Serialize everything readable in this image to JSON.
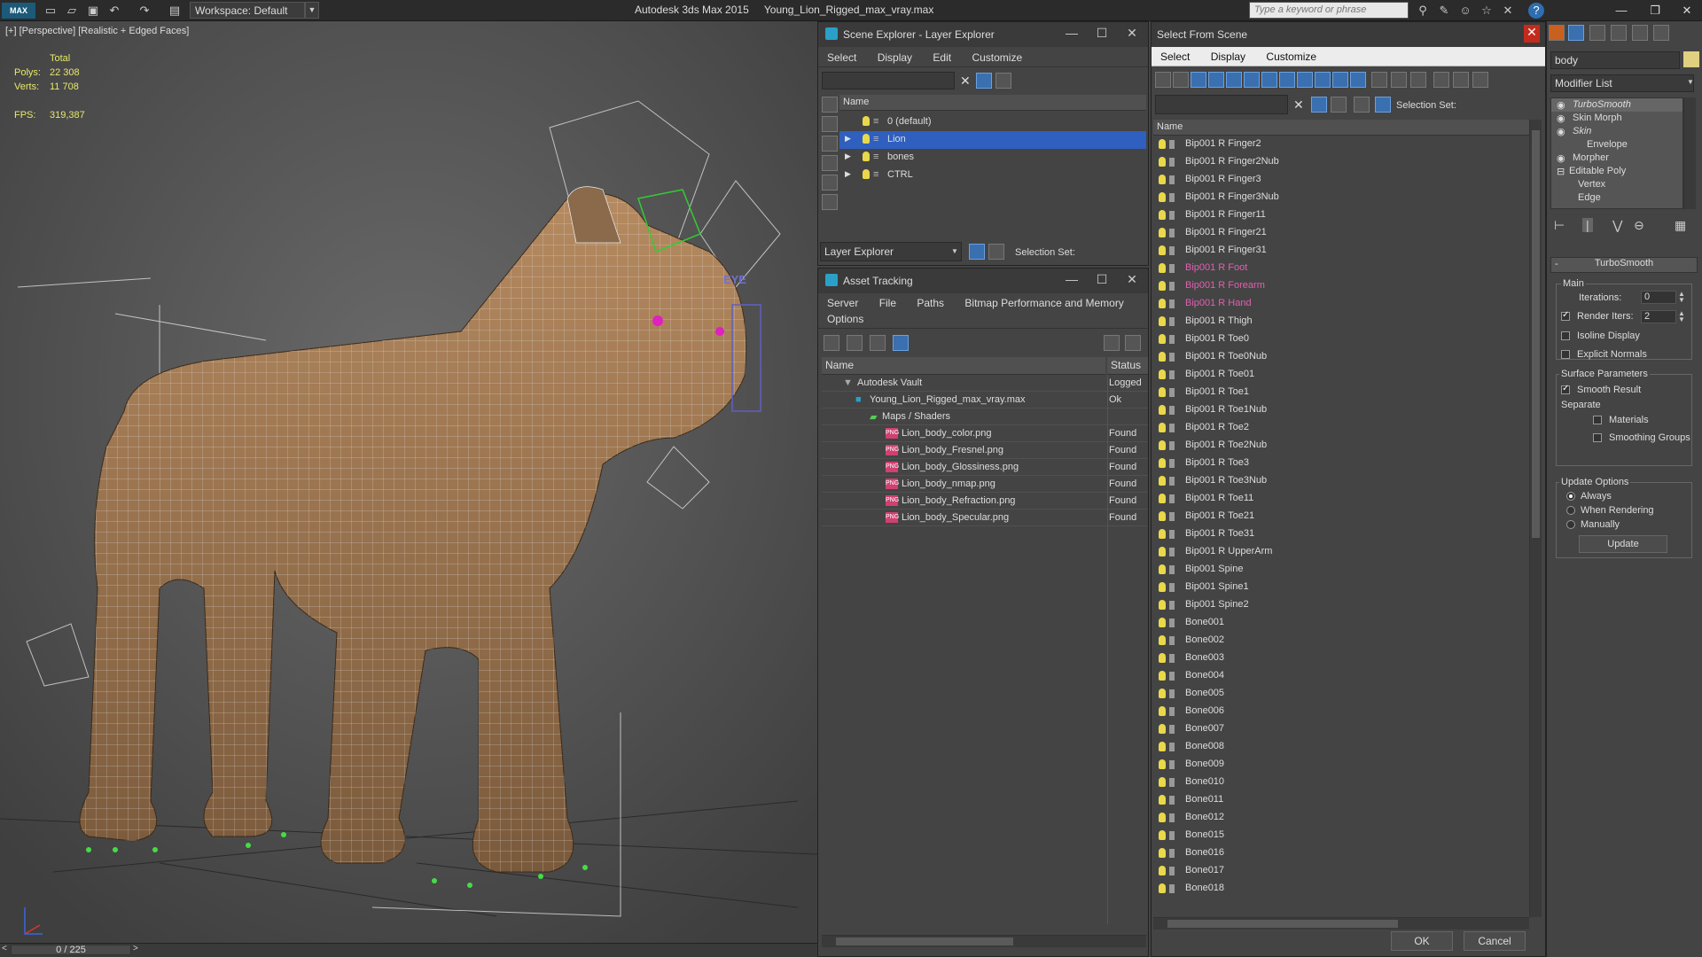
{
  "titlebar": {
    "workspace": "Workspace: Default",
    "app_name": "Autodesk 3ds Max  2015",
    "file_name": "Young_Lion_Rigged_max_vray.max",
    "search_placeholder": "Type a keyword or phrase"
  },
  "viewport": {
    "label": "[+] [Perspective] [Realistic + Edged Faces]",
    "stats": {
      "total_label": "Total",
      "polys_label": "Polys:",
      "polys_value": "22 308",
      "verts_label": "Verts:",
      "verts_value": "11 708",
      "fps_label": "FPS:",
      "fps_value": "319,387"
    },
    "eye_label": "EYE",
    "time_slider": "0 / 225"
  },
  "scene_explorer": {
    "title": "Scene Explorer - Layer Explorer",
    "menu": [
      "Select",
      "Display",
      "Edit",
      "Customize"
    ],
    "column_name": "Name",
    "layers": [
      {
        "name": "0 (default)",
        "selected": false,
        "expandable": false
      },
      {
        "name": "Lion",
        "selected": true,
        "expandable": true
      },
      {
        "name": "bones",
        "selected": false,
        "expandable": true
      },
      {
        "name": "CTRL",
        "selected": false,
        "expandable": true
      }
    ],
    "bottom_dropdown": "Layer Explorer",
    "selection_set_label": "Selection Set:"
  },
  "asset_tracking": {
    "title": "Asset Tracking",
    "menu": [
      "Server",
      "File",
      "Paths",
      "Bitmap Performance and Memory"
    ],
    "menu2": [
      "Options"
    ],
    "col_name": "Name",
    "col_status": "Status",
    "rows": [
      {
        "name": "Autodesk Vault",
        "status": "Logged",
        "indent": 1,
        "icon": "vault"
      },
      {
        "name": "Young_Lion_Rigged_max_vray.max",
        "status": "Ok",
        "indent": 2,
        "icon": "max"
      },
      {
        "name": "Maps / Shaders",
        "status": "",
        "indent": 3,
        "icon": "maps"
      },
      {
        "name": "Lion_body_color.png",
        "status": "Found",
        "indent": 4,
        "icon": "png"
      },
      {
        "name": "Lion_body_Fresnel.png",
        "status": "Found",
        "indent": 4,
        "icon": "png"
      },
      {
        "name": "Lion_body_Glossiness.png",
        "status": "Found",
        "indent": 4,
        "icon": "png"
      },
      {
        "name": "Lion_body_nmap.png",
        "status": "Found",
        "indent": 4,
        "icon": "png"
      },
      {
        "name": "Lion_body_Refraction.png",
        "status": "Found",
        "indent": 4,
        "icon": "png"
      },
      {
        "name": "Lion_body_Specular.png",
        "status": "Found",
        "indent": 4,
        "icon": "png"
      }
    ],
    "png_badge": "PNG"
  },
  "select_from_scene": {
    "title": "Select From Scene",
    "menu": [
      "Select",
      "Display",
      "Customize"
    ],
    "selection_set_label": "Selection Set:",
    "column_name": "Name",
    "items": [
      {
        "name": "Bip001 R Finger2",
        "pink": false
      },
      {
        "name": "Bip001 R Finger2Nub",
        "pink": false
      },
      {
        "name": "Bip001 R Finger3",
        "pink": false
      },
      {
        "name": "Bip001 R Finger3Nub",
        "pink": false
      },
      {
        "name": "Bip001 R Finger11",
        "pink": false
      },
      {
        "name": "Bip001 R Finger21",
        "pink": false
      },
      {
        "name": "Bip001 R Finger31",
        "pink": false
      },
      {
        "name": "Bip001 R Foot",
        "pink": true
      },
      {
        "name": "Bip001 R Forearm",
        "pink": true
      },
      {
        "name": "Bip001 R Hand",
        "pink": true
      },
      {
        "name": "Bip001 R Thigh",
        "pink": false
      },
      {
        "name": "Bip001 R Toe0",
        "pink": false
      },
      {
        "name": "Bip001 R Toe0Nub",
        "pink": false
      },
      {
        "name": "Bip001 R Toe01",
        "pink": false
      },
      {
        "name": "Bip001 R Toe1",
        "pink": false
      },
      {
        "name": "Bip001 R Toe1Nub",
        "pink": false
      },
      {
        "name": "Bip001 R Toe2",
        "pink": false
      },
      {
        "name": "Bip001 R Toe2Nub",
        "pink": false
      },
      {
        "name": "Bip001 R Toe3",
        "pink": false
      },
      {
        "name": "Bip001 R Toe3Nub",
        "pink": false
      },
      {
        "name": "Bip001 R Toe11",
        "pink": false
      },
      {
        "name": "Bip001 R Toe21",
        "pink": false
      },
      {
        "name": "Bip001 R Toe31",
        "pink": false
      },
      {
        "name": "Bip001 R UpperArm",
        "pink": false
      },
      {
        "name": "Bip001 Spine",
        "pink": false
      },
      {
        "name": "Bip001 Spine1",
        "pink": false
      },
      {
        "name": "Bip001 Spine2",
        "pink": false
      },
      {
        "name": "Bone001",
        "pink": false
      },
      {
        "name": "Bone002",
        "pink": false
      },
      {
        "name": "Bone003",
        "pink": false
      },
      {
        "name": "Bone004",
        "pink": false
      },
      {
        "name": "Bone005",
        "pink": false
      },
      {
        "name": "Bone006",
        "pink": false
      },
      {
        "name": "Bone007",
        "pink": false
      },
      {
        "name": "Bone008",
        "pink": false
      },
      {
        "name": "Bone009",
        "pink": false
      },
      {
        "name": "Bone010",
        "pink": false
      },
      {
        "name": "Bone011",
        "pink": false
      },
      {
        "name": "Bone012",
        "pink": false
      },
      {
        "name": "Bone015",
        "pink": false
      },
      {
        "name": "Bone016",
        "pink": false
      },
      {
        "name": "Bone017",
        "pink": false
      },
      {
        "name": "Bone018",
        "pink": false
      }
    ],
    "ok_label": "OK",
    "cancel_label": "Cancel"
  },
  "command_panel": {
    "object_name": "body",
    "modifier_list": "Modifier List",
    "stack": [
      {
        "name": "TurboSmooth",
        "italic": true,
        "indent": 0
      },
      {
        "name": "Skin Morph",
        "italic": false,
        "indent": 0
      },
      {
        "name": "Skin",
        "italic": true,
        "indent": 0
      },
      {
        "name": "Envelope",
        "italic": false,
        "indent": 1
      },
      {
        "name": "Morpher",
        "italic": false,
        "indent": 0
      },
      {
        "name": "Editable Poly",
        "italic": false,
        "indent": 0
      },
      {
        "name": "Vertex",
        "italic": false,
        "indent": 1
      },
      {
        "name": "Edge",
        "italic": false,
        "indent": 1
      }
    ],
    "rollout_title": "TurboSmooth",
    "main_label": "Main",
    "iterations_label": "Iterations:",
    "iterations_value": "0",
    "render_iters_label": "Render Iters:",
    "render_iters_value": "2",
    "render_iters_checked": true,
    "isoline_label": "Isoline Display",
    "explicit_normals_label": "Explicit Normals",
    "surface_params_label": "Surface Parameters",
    "smooth_result_label": "Smooth Result",
    "separate_label": "Separate",
    "materials_label": "Materials",
    "smoothing_groups_label": "Smoothing Groups",
    "update_options_label": "Update Options",
    "always_label": "Always",
    "when_rendering_label": "When Rendering",
    "manually_label": "Manually",
    "update_button": "Update"
  },
  "colors": {
    "accent_blue": "#2f5fbf",
    "pink_item": "#e060b0",
    "stat_yellow": "#e8e86a"
  }
}
